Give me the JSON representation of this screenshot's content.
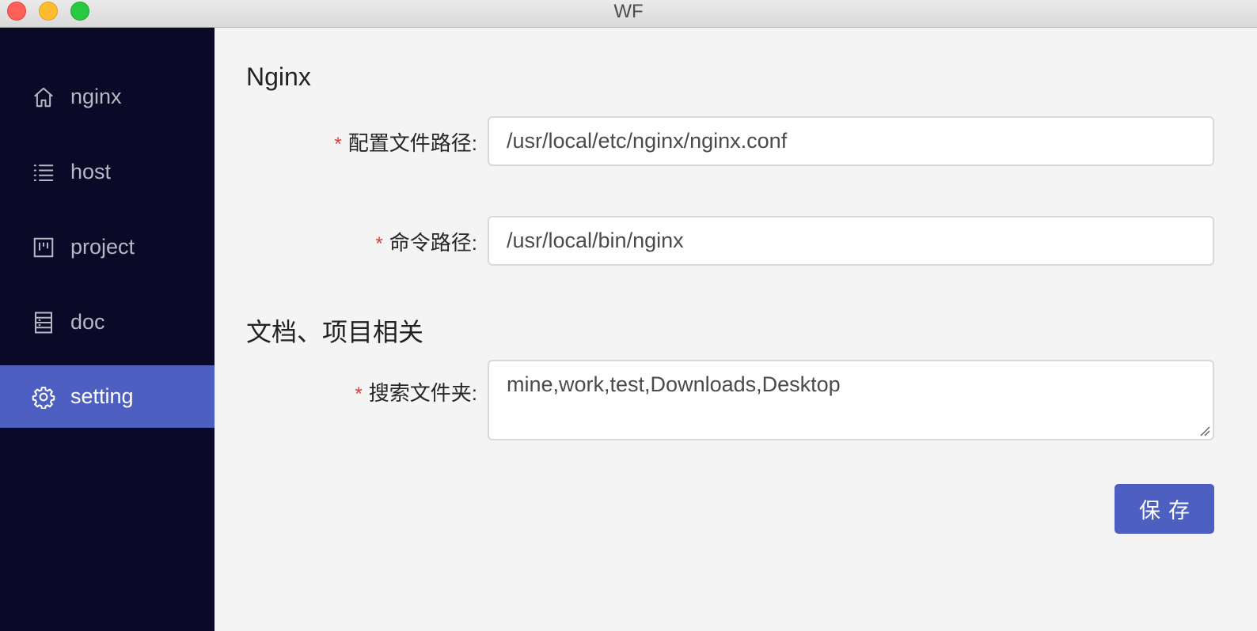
{
  "window": {
    "title": "WF"
  },
  "sidebar": {
    "items": [
      {
        "label": "nginx",
        "icon": "home-icon",
        "active": false
      },
      {
        "label": "host",
        "icon": "list-icon",
        "active": false
      },
      {
        "label": "project",
        "icon": "project-board-icon",
        "active": false
      },
      {
        "label": "doc",
        "icon": "document-icon",
        "active": false
      },
      {
        "label": "setting",
        "icon": "gear-icon",
        "active": true
      }
    ]
  },
  "main": {
    "nginx_section": {
      "title": "Nginx",
      "config_path": {
        "required": "*",
        "label": "配置文件路径:",
        "value": "/usr/local/etc/nginx/nginx.conf"
      },
      "command_path": {
        "required": "*",
        "label": "命令路径:",
        "value": "/usr/local/bin/nginx"
      }
    },
    "docs_section": {
      "title": "文档、项目相关",
      "search_folders": {
        "required": "*",
        "label": "搜索文件夹:",
        "value": "mine,work,test,Downloads,Desktop"
      }
    },
    "save_label": "保存"
  },
  "colors": {
    "sidebar_bg": "#0a0a28",
    "accent": "#4e5fc2",
    "required": "#e53935"
  }
}
